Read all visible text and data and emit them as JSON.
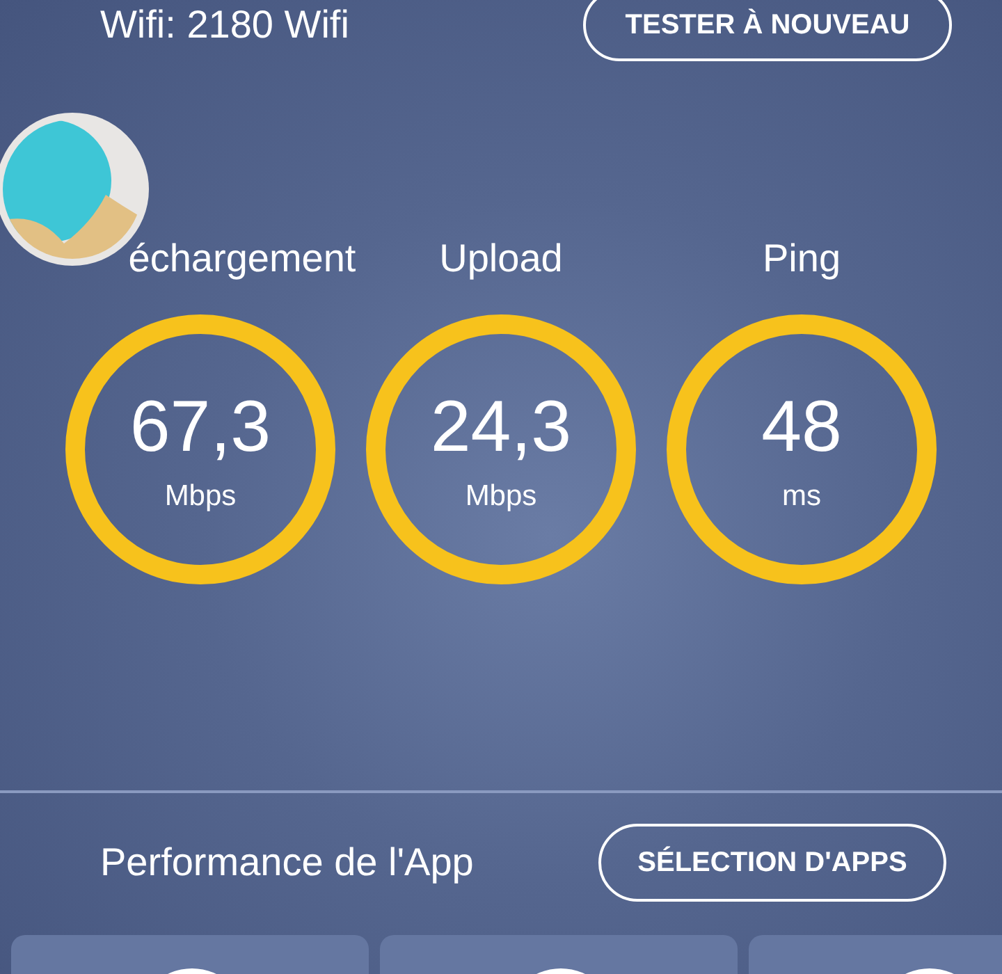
{
  "header": {
    "network": "Wifi: 2180 Wifi",
    "retest_button": "TESTER À NOUVEAU"
  },
  "metrics": [
    {
      "label": "échargement",
      "value": "67,3",
      "unit": "Mbps"
    },
    {
      "label": "Upload",
      "value": "24,3",
      "unit": "Mbps"
    },
    {
      "label": "Ping",
      "value": "48",
      "unit": "ms"
    }
  ],
  "app_performance": {
    "title": "Performance de l'App",
    "select_button": "SÉLECTION D'APPS",
    "cards": [
      {
        "kind": "app"
      },
      {
        "kind": "app"
      },
      {
        "kind": "app"
      }
    ]
  }
}
